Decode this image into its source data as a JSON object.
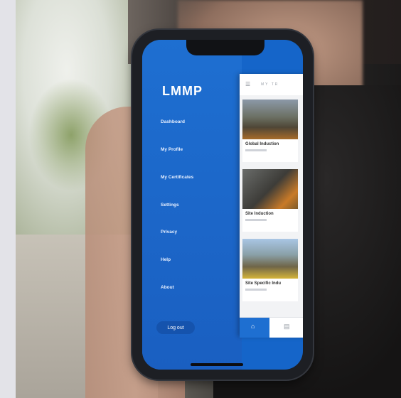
{
  "app": {
    "logo_text": "LMMP",
    "menu": [
      {
        "label": "Dashboard"
      },
      {
        "label": "My Profile"
      },
      {
        "label": "My Certificates"
      },
      {
        "label": "Settings"
      },
      {
        "label": "Privacy"
      },
      {
        "label": "Help"
      },
      {
        "label": "About"
      }
    ],
    "logout_label": "Log out",
    "content_header": "MY TR",
    "cards": [
      {
        "title": "Global Induction"
      },
      {
        "title": "Site Induction"
      },
      {
        "title": "Site Specific Indu"
      }
    ]
  },
  "colors": {
    "brand_blue": "#1e6fd1",
    "menu_text": "#e8f0ff"
  }
}
